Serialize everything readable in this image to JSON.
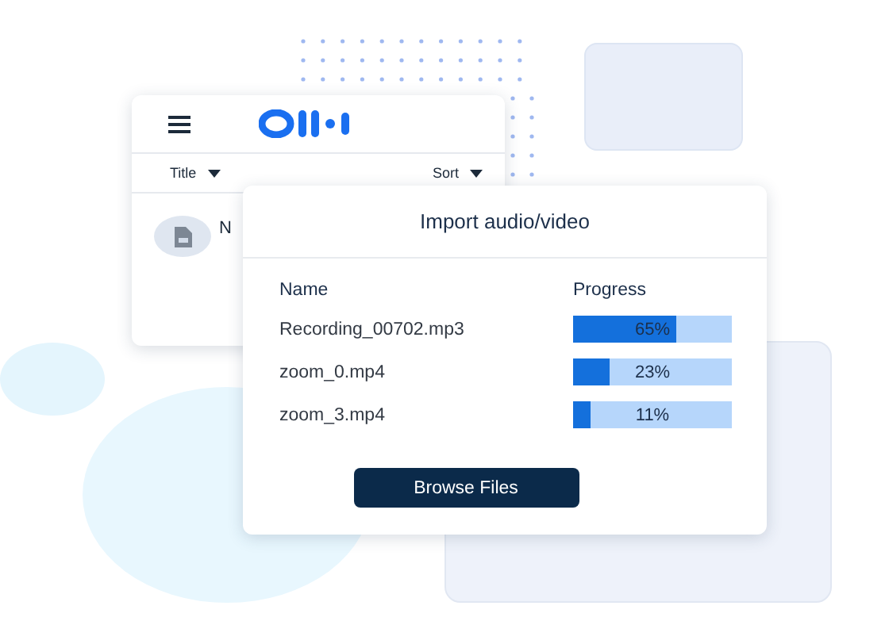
{
  "library_card": {
    "sort_controls": [
      {
        "label": "Title"
      },
      {
        "label": "Sort"
      }
    ],
    "items": [
      {
        "title": "N"
      }
    ]
  },
  "import_dialog": {
    "title": "Import audio/video",
    "columns": [
      "Name",
      "Progress"
    ],
    "files": [
      {
        "name": "Recording_00702.mp3",
        "level": 0.65,
        "reading": "65%"
      },
      {
        "name": "zoom_0.mp4",
        "level": 0.23,
        "reading": "23%"
      },
      {
        "name": "zoom_3.mp4",
        "level": 0.11,
        "reading": "11%"
      }
    ],
    "button": "Browse Files"
  }
}
